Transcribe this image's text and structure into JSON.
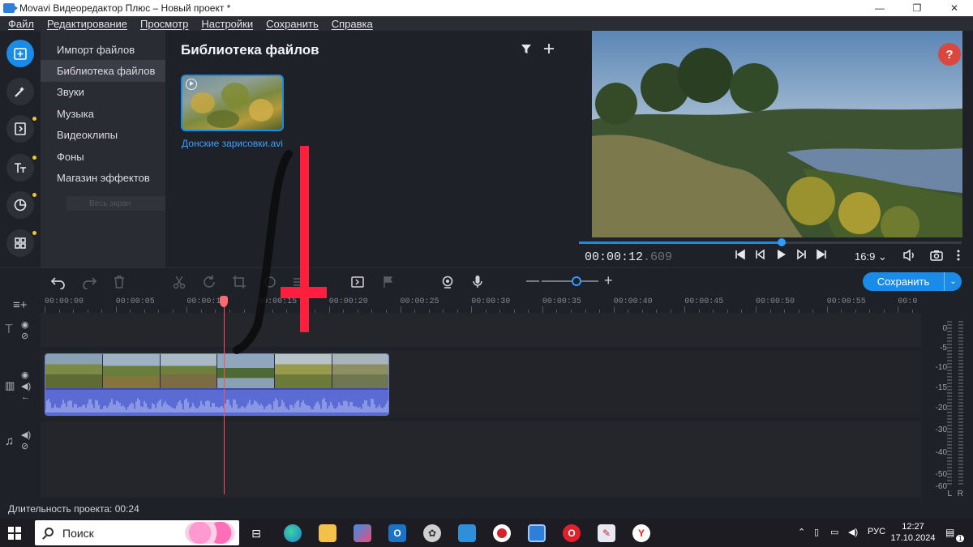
{
  "window": {
    "title": "Movavi Видеоредактор Плюс – Новый проект *",
    "minimize_glyph": "—",
    "maximize_glyph": "❐",
    "close_glyph": "✕"
  },
  "menu": [
    "Файл",
    "Редактирование",
    "Просмотр",
    "Настройки",
    "Сохранить",
    "Справка"
  ],
  "rail": {
    "icons": [
      "import-icon",
      "magic-wand-icon",
      "transitions-icon",
      "titles-icon",
      "stickers-icon",
      "more-tools-icon"
    ]
  },
  "categories": [
    "Импорт файлов",
    "Библиотека файлов",
    "Звуки",
    "Музыка",
    "Видеоклипы",
    "Фоны",
    "Магазин эффектов"
  ],
  "category_tooltip": "Весь экран",
  "library": {
    "title": "Библиотека файлов",
    "file_name": "Донские зарисовки.avi"
  },
  "preview": {
    "help_label": "?",
    "timecode_main": "00:00:12",
    "timecode_ms": ".609",
    "progress": 0.53,
    "aspect": "16:9 ⌄"
  },
  "toolbar": {
    "save_label": "Сохранить",
    "save_arrow": "⌄",
    "zoom_minus": "—",
    "zoom_plus": "+",
    "zoom_level": 0.62
  },
  "timeline": {
    "ruler": [
      "00:00:00",
      "00:00:05",
      "00:00:10",
      "00:00:15",
      "00:00:20",
      "00:00:25",
      "00:00:30",
      "00:00:35",
      "00:00:40",
      "00:00:45",
      "00:00:50",
      "00:00:55",
      "00:0"
    ],
    "playhead_seconds": 12.6
  },
  "meter": {
    "labels": [
      "0",
      "-5",
      "-10",
      "-15",
      "-20",
      "-30",
      "-40",
      "-50",
      "-60"
    ],
    "channels": [
      "L",
      "R"
    ]
  },
  "status": {
    "duration_text": "Длительность проекта: 00:24"
  },
  "taskbar": {
    "search_placeholder": "Поиск",
    "language": "РУС",
    "time": "12:27",
    "date": "17.10.2024",
    "notification_count": "1"
  },
  "colors": {
    "accent": "#1a8ce8",
    "playhead": "#ff4c5a",
    "help": "#d9473e",
    "overlay_cross": "#ff1f3d"
  }
}
